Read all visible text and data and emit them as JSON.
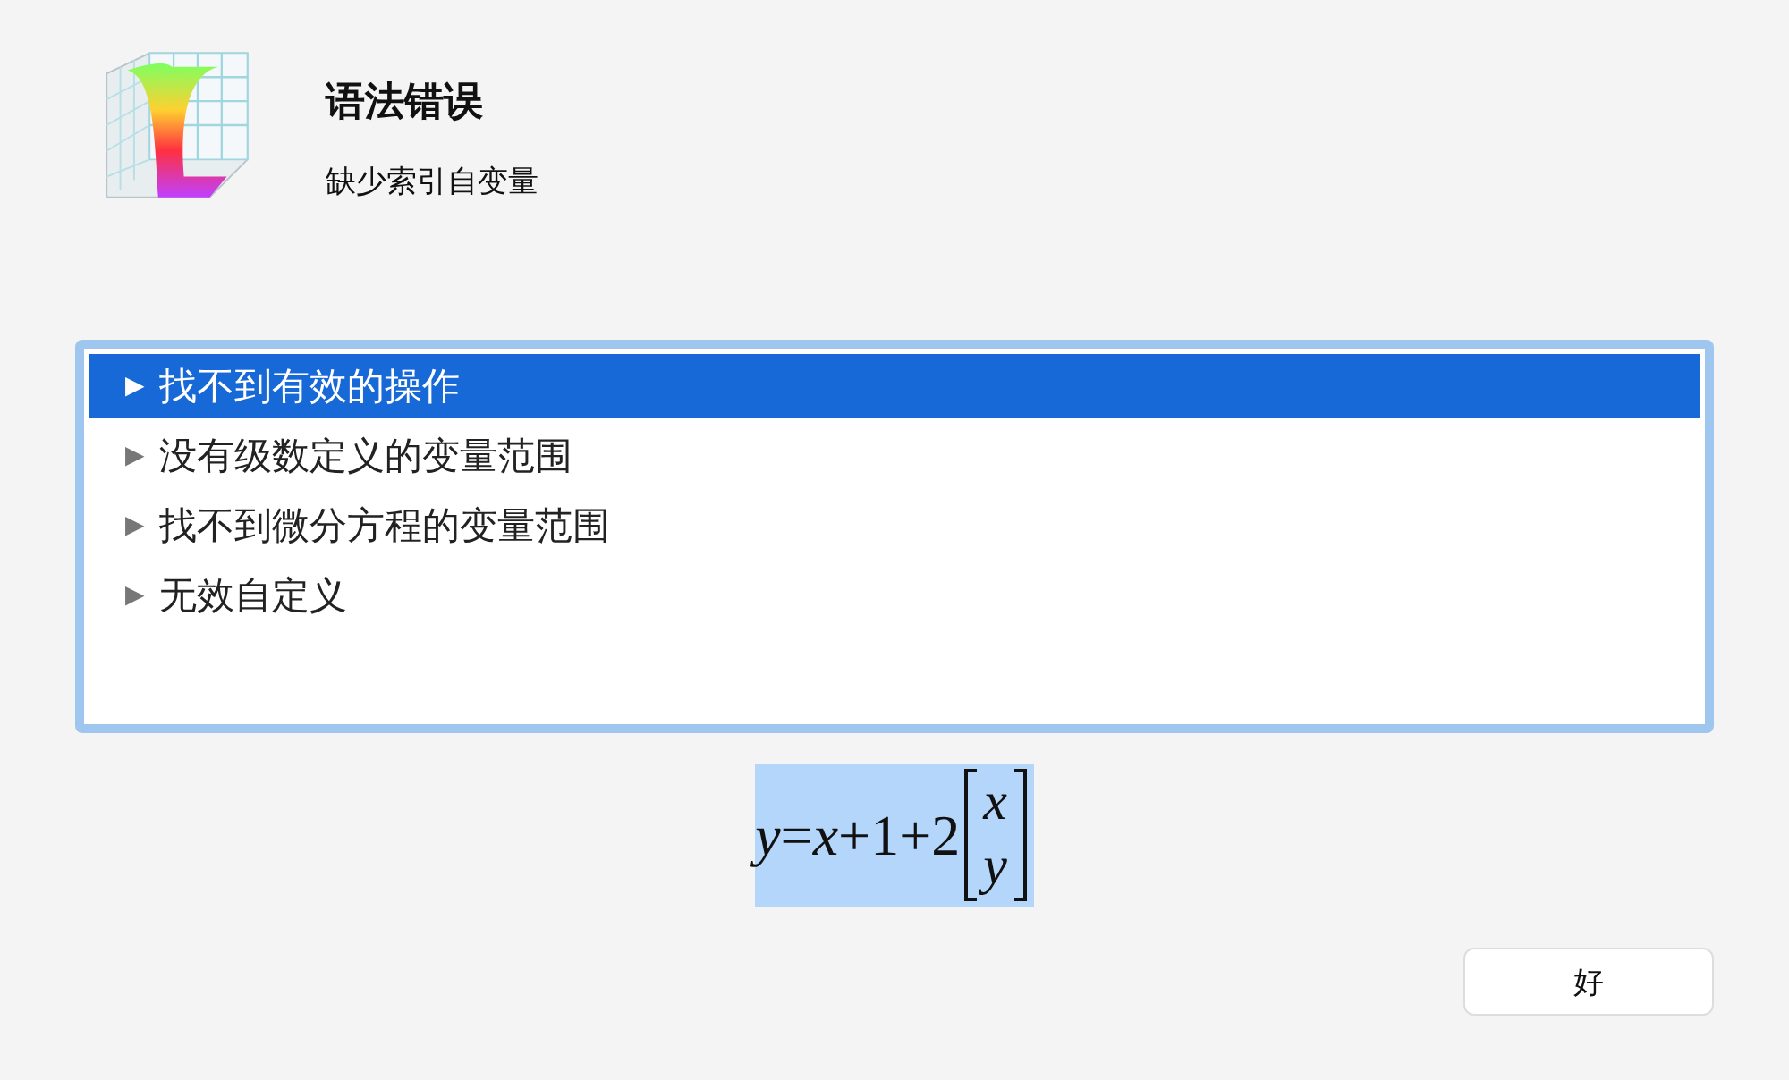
{
  "dialog": {
    "title": "语法错误",
    "message": "缺少索引自变量"
  },
  "list": [
    {
      "marker": "▶",
      "label": "找不到有效的操作",
      "selected": true
    },
    {
      "marker": "▶",
      "label": "没有级数定义的变量范围",
      "selected": false
    },
    {
      "marker": "▶",
      "label": "找不到微分方程的变量范围",
      "selected": false
    },
    {
      "marker": "▶",
      "label": "无效自定义",
      "selected": false
    }
  ],
  "formula": {
    "expression": "*y*=*x*+1+2",
    "matrix": [
      "x",
      "y"
    ]
  },
  "buttons": [
    "好"
  ]
}
